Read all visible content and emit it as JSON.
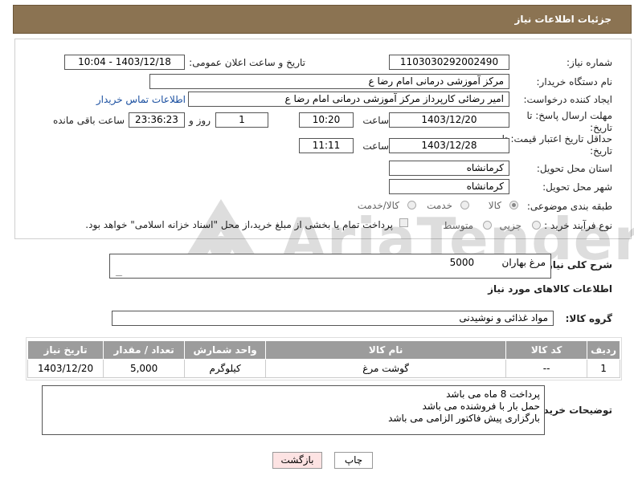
{
  "header": {
    "title": "جزئیات اطلاعات نیاز"
  },
  "form": {
    "need_number_label": "شماره نیاز:",
    "need_number": "1103030292002490",
    "announce_label": "تاریخ و ساعت اعلان عمومی:",
    "announce_value": "1403/12/18 - 10:04",
    "buyer_org_label": "نام دستگاه خریدار:",
    "buyer_org": "مرکز آموزشی  درمانی امام رضا  ع",
    "requester_label": "ایجاد کننده درخواست:",
    "requester": "امیر رضائی کارپرداز مرکز آموزشی  درمانی امام رضا  ع",
    "contact_link": "اطلاعات تماس خریدار",
    "deadline_label": "مهلت ارسال پاسخ: تا تاریخ:",
    "deadline_date": "1403/12/20",
    "time_label": "ساعت",
    "deadline_time": "10:20",
    "days_value": "1",
    "days_label": "روز و",
    "remaining_time": "23:36:23",
    "remaining_label": "ساعت باقی مانده",
    "validity_label": "حداقل تاریخ اعتبار قیمت: تا تاریخ:",
    "validity_date": "1403/12/28",
    "validity_time_label": "ساعت",
    "validity_time": "11:11",
    "province_label": "استان محل تحویل:",
    "province": "کرمانشاه",
    "city_label": "شهر محل تحویل:",
    "city": "کرمانشاه",
    "category_label": "طبقه بندی موضوعی:",
    "category_options": [
      "کالا",
      "خدمت",
      "کالا/خدمت"
    ],
    "category_selected": "کالا",
    "process_label": "نوع فرآیند خرید :",
    "process_options": [
      "جزیی",
      "متوسط"
    ],
    "payment_note": "پرداخت تمام یا بخشی از مبلغ خرید،از محل \"اسناد خزانه اسلامی\" خواهد بود."
  },
  "summary": {
    "label": "شرح کلی نیاز:",
    "value": "مرغ بهاران         5000"
  },
  "goods_info_title": "اطلاعات کالاهای مورد نیاز",
  "goods_group": {
    "label": "گروه کالا:",
    "value": "مواد غذائی و نوشیدنی"
  },
  "table": {
    "headers": [
      "ردیف",
      "کد کالا",
      "نام کالا",
      "واحد شمارش",
      "تعداد / مقدار",
      "تاریخ نیاز"
    ],
    "rows": [
      [
        "1",
        "--",
        "گوشت مرغ",
        "کیلوگرم",
        "5,000",
        "1403/12/20"
      ]
    ]
  },
  "buyer_notes": {
    "label": "توضیحات خریدار:",
    "lines": [
      "پرداخت 8 ماه می باشد",
      "حمل بار با فروشنده می باشد",
      "بارگزاری پیش فاکتور الزامی می باشد"
    ]
  },
  "buttons": {
    "print": "چاپ",
    "back": "بازگشت"
  },
  "watermark": {
    "text": "AriaTender.neT"
  },
  "colors": {
    "header_bg": "#8b7352",
    "table_header_bg": "#9c9c9c",
    "back_button_bg": "#fde3e3",
    "link": "#1a4fa0"
  }
}
